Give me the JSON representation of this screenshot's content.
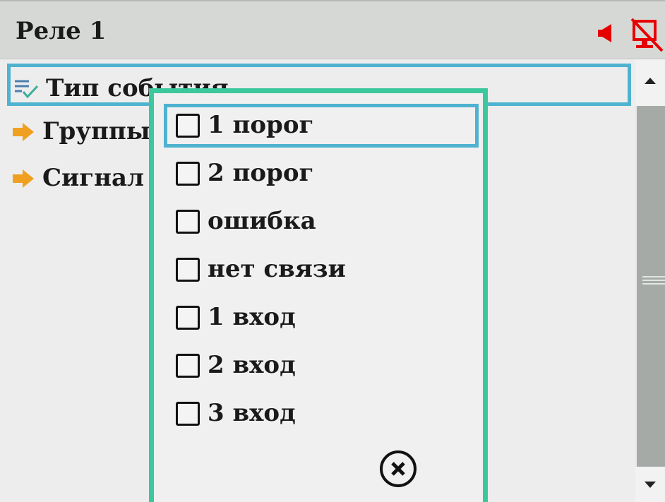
{
  "header": {
    "title": "Реле 1",
    "icons": [
      "speaker-icon",
      "no-screen-icon"
    ],
    "accent_color": "#e60000"
  },
  "menu": {
    "items": [
      {
        "label": "Тип события",
        "icon": "checklist-icon",
        "selected": true
      },
      {
        "label": "Группы",
        "icon": "arrow-right-icon",
        "selected": false
      },
      {
        "label": "Сигнал",
        "icon": "arrow-right-icon",
        "selected": false
      }
    ]
  },
  "popup": {
    "options": [
      {
        "label": "1 порог",
        "checked": false,
        "focused": true
      },
      {
        "label": "2 порог",
        "checked": false
      },
      {
        "label": "ошибка",
        "checked": false
      },
      {
        "label": "нет связи",
        "checked": false
      },
      {
        "label": "1 вход",
        "checked": false
      },
      {
        "label": "2 вход",
        "checked": false
      },
      {
        "label": "3 вход",
        "checked": false
      }
    ],
    "close_icon": "close-icon",
    "border_color": "#3cc79c",
    "focus_color": "#4fb3d0"
  },
  "scrollbar": {
    "up_icon": "arrow-up-icon",
    "down_icon": "arrow-down-icon"
  }
}
